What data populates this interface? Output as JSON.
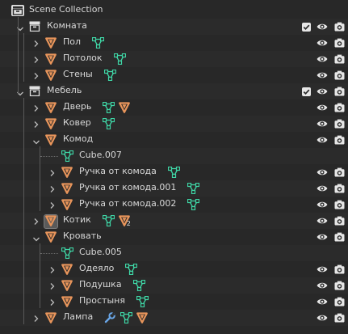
{
  "outliner": {
    "rows": [
      {
        "type": "scene",
        "depth": 0,
        "label": "Scene Collection",
        "expander": "none",
        "extras": [],
        "controls": []
      },
      {
        "type": "collection",
        "depth": 1,
        "label": "Комната",
        "expander": "open",
        "extras": [],
        "controls": [
          "checkbox",
          "eye",
          "camera"
        ]
      },
      {
        "type": "object",
        "depth": 2,
        "label": "Пол",
        "expander": "closed",
        "extras": [
          "mesh-data"
        ],
        "controls": [
          "eye",
          "camera"
        ]
      },
      {
        "type": "object",
        "depth": 2,
        "label": "Потолок",
        "expander": "closed",
        "extras": [
          "mesh-data"
        ],
        "controls": [
          "eye",
          "camera"
        ]
      },
      {
        "type": "object",
        "depth": 2,
        "label": "Стены",
        "expander": "closed",
        "extras": [
          "mesh-data"
        ],
        "controls": [
          "eye",
          "camera"
        ]
      },
      {
        "type": "collection",
        "depth": 1,
        "label": "Мебель",
        "expander": "open",
        "extras": [],
        "controls": [
          "checkbox",
          "eye",
          "camera"
        ]
      },
      {
        "type": "object",
        "depth": 2,
        "label": "Дверь",
        "expander": "closed",
        "extras": [
          "mesh-data",
          "object"
        ],
        "controls": [
          "eye",
          "camera"
        ]
      },
      {
        "type": "object",
        "depth": 2,
        "label": "Ковер",
        "expander": "closed",
        "extras": [
          "mesh-data"
        ],
        "controls": [
          "eye",
          "camera"
        ]
      },
      {
        "type": "object",
        "depth": 2,
        "label": "Комод",
        "expander": "open",
        "extras": [],
        "controls": [
          "eye",
          "camera"
        ]
      },
      {
        "type": "mesh",
        "depth": 3,
        "label": "Cube.007",
        "expander": "none",
        "extras": [],
        "controls": []
      },
      {
        "type": "object",
        "depth": 3,
        "label": "Ручка от комода",
        "expander": "closed",
        "extras": [
          "mesh-data"
        ],
        "controls": [
          "eye",
          "camera"
        ]
      },
      {
        "type": "object",
        "depth": 3,
        "label": "Ручка от комода.001",
        "expander": "closed",
        "extras": [
          "mesh-data"
        ],
        "controls": [
          "eye",
          "camera"
        ]
      },
      {
        "type": "object",
        "depth": 3,
        "label": "Ручка от комода.002",
        "expander": "closed",
        "extras": [
          "mesh-data"
        ],
        "controls": [
          "eye",
          "camera"
        ]
      },
      {
        "type": "object",
        "depth": 2,
        "label": "Котик",
        "expander": "closed",
        "active": true,
        "extras": [
          "mesh-data",
          "object-count"
        ],
        "count": "2",
        "controls": [
          "eye",
          "camera"
        ]
      },
      {
        "type": "object",
        "depth": 2,
        "label": "Кровать",
        "expander": "open",
        "extras": [],
        "controls": [
          "eye",
          "camera"
        ]
      },
      {
        "type": "mesh",
        "depth": 3,
        "label": "Cube.005",
        "expander": "none",
        "extras": [],
        "controls": []
      },
      {
        "type": "object",
        "depth": 3,
        "label": "Одеяло",
        "expander": "closed",
        "extras": [
          "mesh-data"
        ],
        "controls": [
          "eye",
          "camera"
        ]
      },
      {
        "type": "object",
        "depth": 3,
        "label": "Подушка",
        "expander": "closed",
        "extras": [
          "mesh-data"
        ],
        "controls": [
          "eye",
          "camera"
        ]
      },
      {
        "type": "object",
        "depth": 3,
        "label": "Простыня",
        "expander": "closed",
        "extras": [
          "mesh-data"
        ],
        "controls": [
          "eye",
          "camera"
        ]
      },
      {
        "type": "object",
        "depth": 2,
        "label": "Лампа",
        "expander": "closed",
        "extras": [
          "wrench",
          "mesh-data",
          "object"
        ],
        "controls": [
          "eye",
          "camera"
        ]
      }
    ]
  },
  "colors": {
    "background": "#282828",
    "object_orange": "#e8955b",
    "mesh_green": "#3fd6a6",
    "text": "#d8d8d8",
    "wrench_blue": "#6aa7e8"
  }
}
